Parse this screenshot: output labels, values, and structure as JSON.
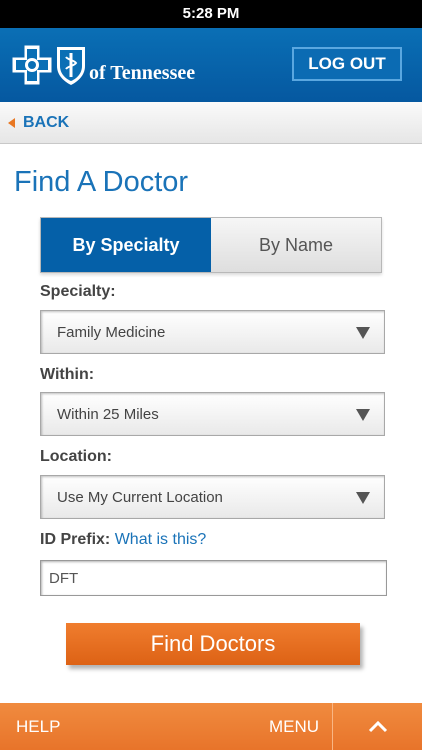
{
  "status_bar": {
    "time": "5:28 PM"
  },
  "header": {
    "logo_text": "of Tennessee",
    "logout_label": "LOG OUT",
    "colors": {
      "primary": "#0558a0",
      "accent": "#e87722"
    }
  },
  "nav": {
    "back_label": "BACK"
  },
  "page": {
    "title": "Find A Doctor"
  },
  "tabs": [
    {
      "label": "By Specialty",
      "active": true
    },
    {
      "label": "By Name",
      "active": false
    }
  ],
  "form": {
    "specialty": {
      "label": "Specialty:",
      "value": "Family Medicine"
    },
    "within": {
      "label": "Within:",
      "value": "Within 25 Miles"
    },
    "location": {
      "label": "Location:",
      "value": "Use My Current Location"
    },
    "id_prefix": {
      "label": "ID Prefix:",
      "link": "What is this?",
      "value": "DFT"
    }
  },
  "find_button": {
    "label": "Find Doctors"
  },
  "footer": {
    "help_label": "HELP",
    "menu_label": "MENU",
    "up_icon": "chevron-up-icon"
  }
}
